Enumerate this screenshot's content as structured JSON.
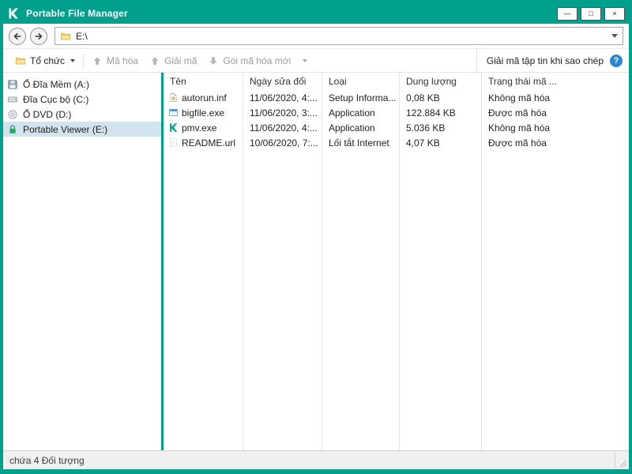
{
  "colors": {
    "accent": "#00a08c",
    "selected_item_bg": "#d2e3ee",
    "help_icon": "#2f86d1",
    "statusbar_bg": "#f0f0f0"
  },
  "titlebar": {
    "title": "Portable File Manager",
    "minimize_label": "—",
    "maximize_label": "□",
    "close_label": "×"
  },
  "navigation": {
    "path": "E:\\"
  },
  "toolbar": {
    "organize_label": "Tổ chức",
    "encrypt_label": "Mã hóa",
    "decrypt_label": "Giải mã",
    "new_package_label": "Gói mã hóa mới",
    "decrypt_on_copy_label": "Giải mã tập tin khi sao chép",
    "help_label": "?"
  },
  "sidebar": {
    "items": [
      {
        "label": "Ổ Đĩa Mềm (A:)",
        "icon": "floppy-icon"
      },
      {
        "label": "Đĩa Cục bộ (C:)",
        "icon": "hard-drive-icon"
      },
      {
        "label": "Ổ DVD (D:)",
        "icon": "dvd-icon"
      },
      {
        "label": "Portable Viewer (E:)",
        "icon": "lock-icon",
        "selected": true
      }
    ]
  },
  "file_list": {
    "columns": [
      "Tên",
      "Ngày sửa đổi",
      "Loại",
      "Dung lượng",
      "Trạng thái mã ..."
    ],
    "rows": [
      {
        "name": "autorun.inf",
        "icon": "inf-file-icon",
        "modified": "11/06/2020, 4:...",
        "type": "Setup Informa...",
        "size": "0,08 KB",
        "status": "Không mã hóa"
      },
      {
        "name": "bigfile.exe",
        "icon": "exe-file-icon",
        "modified": "11/06/2020, 3:...",
        "type": "Application",
        "size": "122.884 KB",
        "status": "Được mã hóa"
      },
      {
        "name": "pmv.exe",
        "icon": "kaspersky-file-icon",
        "modified": "11/06/2020, 4:...",
        "type": "Application",
        "size": "5.036 KB",
        "status": "Không mã hóa"
      },
      {
        "name": "README.url",
        "icon": "url-file-icon",
        "modified": "10/06/2020, 7:...",
        "type": "Lối tắt Internet",
        "size": "4,07 KB",
        "status": "Được mã hóa"
      }
    ]
  },
  "status_bar": {
    "text": "chứa 4 Đối tượng"
  }
}
